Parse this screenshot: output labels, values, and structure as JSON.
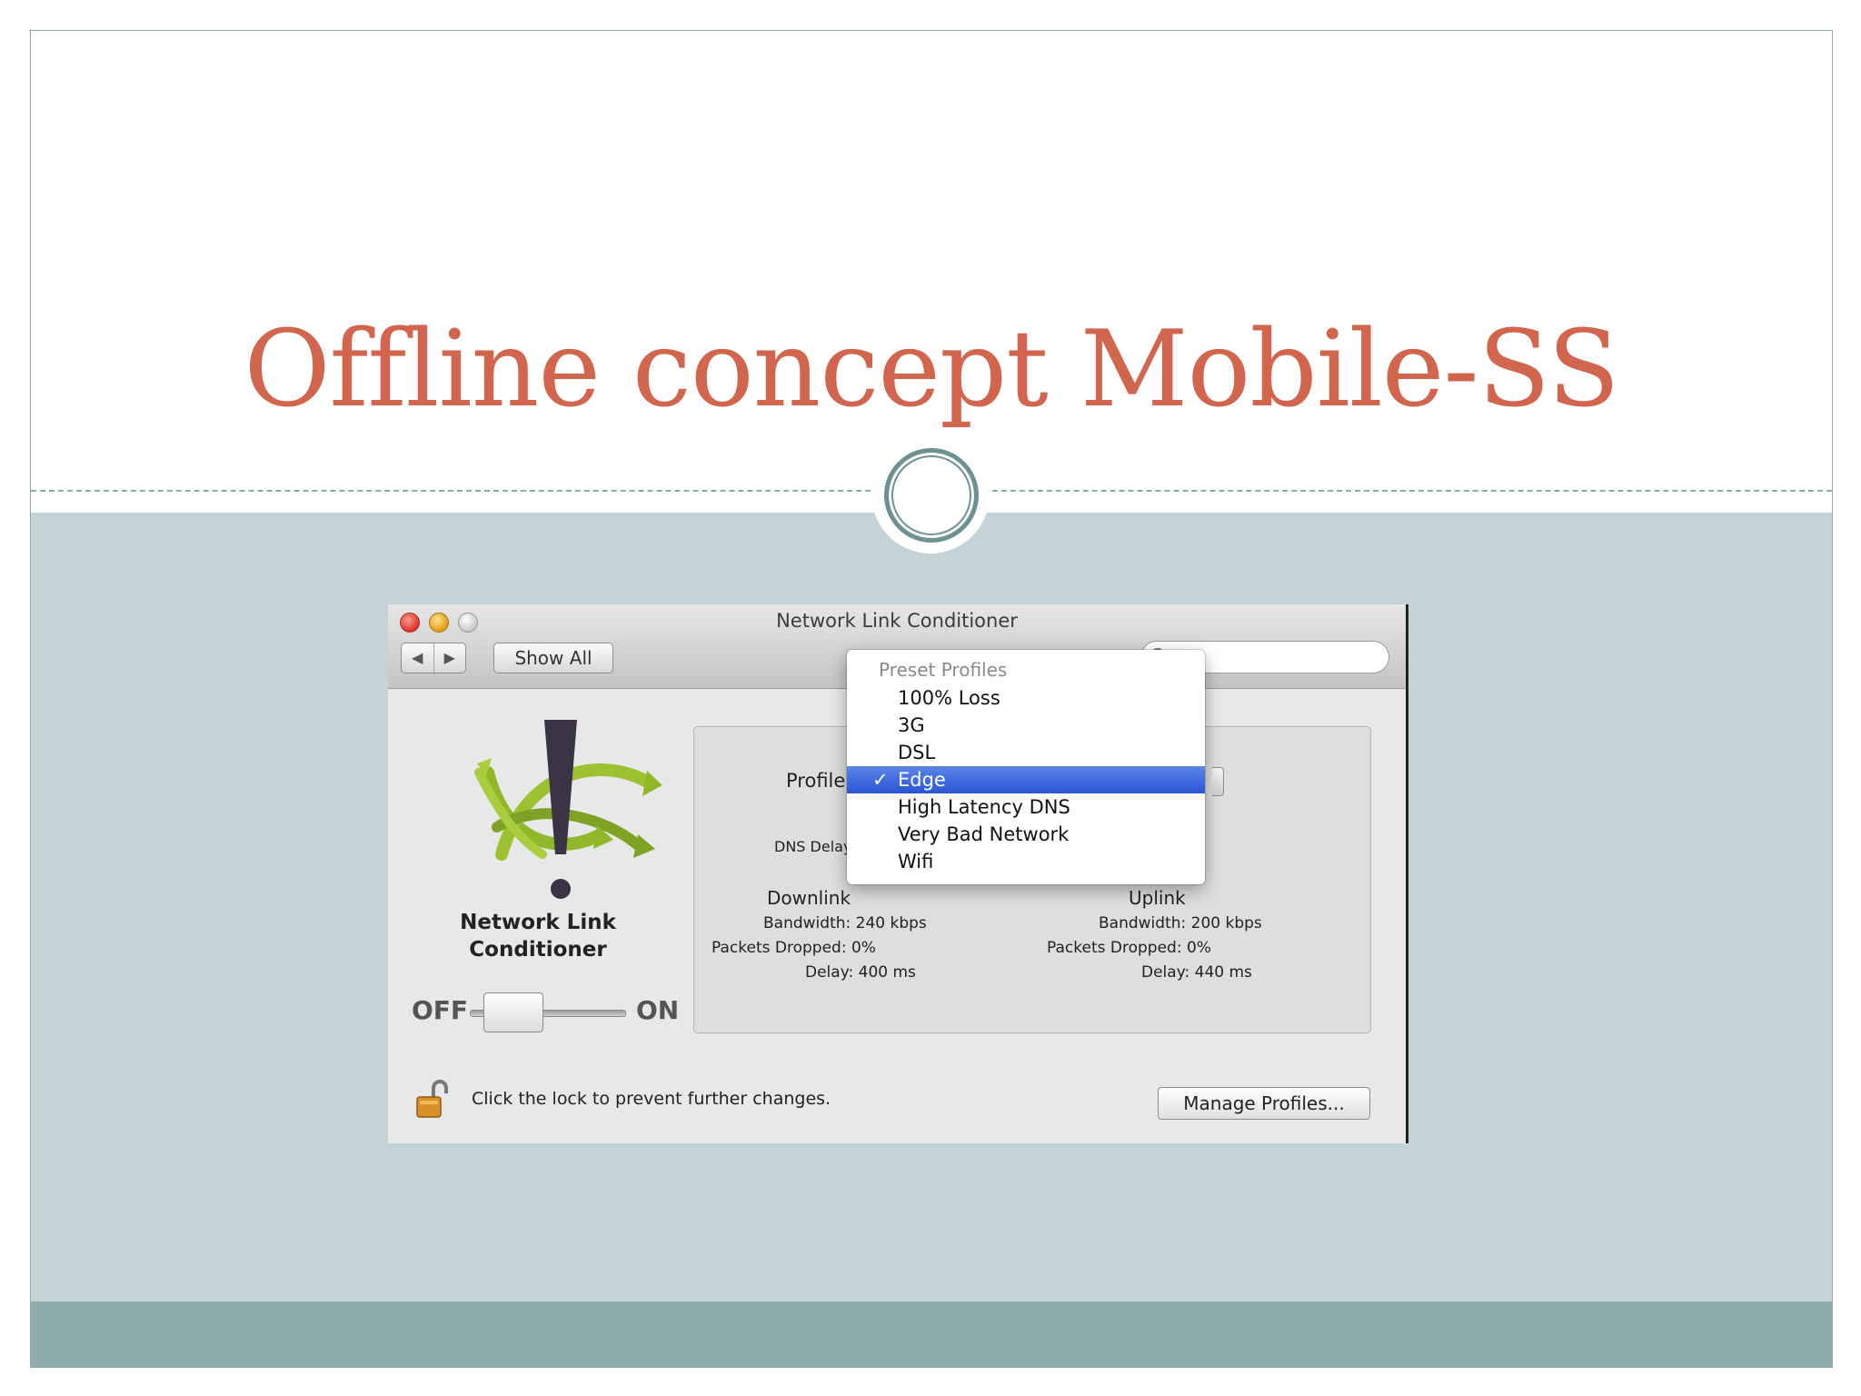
{
  "slide": {
    "title": "Offline concept Mobile-SS"
  },
  "window": {
    "title": "Network Link Conditioner",
    "nav_back_glyph": "◀",
    "nav_forward_glyph": "▶",
    "show_all_label": "Show All",
    "pref_name_line1": "Network Link",
    "pref_name_line2": "Conditioner",
    "off_label": "OFF",
    "on_label": "ON",
    "toggle_state": "off",
    "profile_label": "Profile",
    "dns_delay_label": "DNS Delay",
    "downlink": {
      "heading": "Downlink",
      "bandwidth": "Bandwidth: 240 kbps",
      "packets_dropped": "Packets Dropped: 0%",
      "delay": "Delay: 400 ms"
    },
    "uplink": {
      "heading": "Uplink",
      "bandwidth": "Bandwidth: 200 kbps",
      "packets_dropped": "Packets Dropped: 0%",
      "delay": "Delay: 440 ms"
    },
    "lock_text": "Click the lock to prevent further changes.",
    "manage_profiles_label": "Manage Profiles..."
  },
  "profile_menu": {
    "header": "Preset Profiles",
    "check_glyph": "✓",
    "items": [
      "100% Loss",
      "3G",
      "DSL",
      "Edge",
      "High Latency DNS",
      "Very Bad Network",
      "Wifi"
    ],
    "selected": "Edge"
  },
  "colors": {
    "title": "#d1654e",
    "panel": "#c3d4d6",
    "footer": "#8fadad",
    "selection": "#2b55d6"
  }
}
